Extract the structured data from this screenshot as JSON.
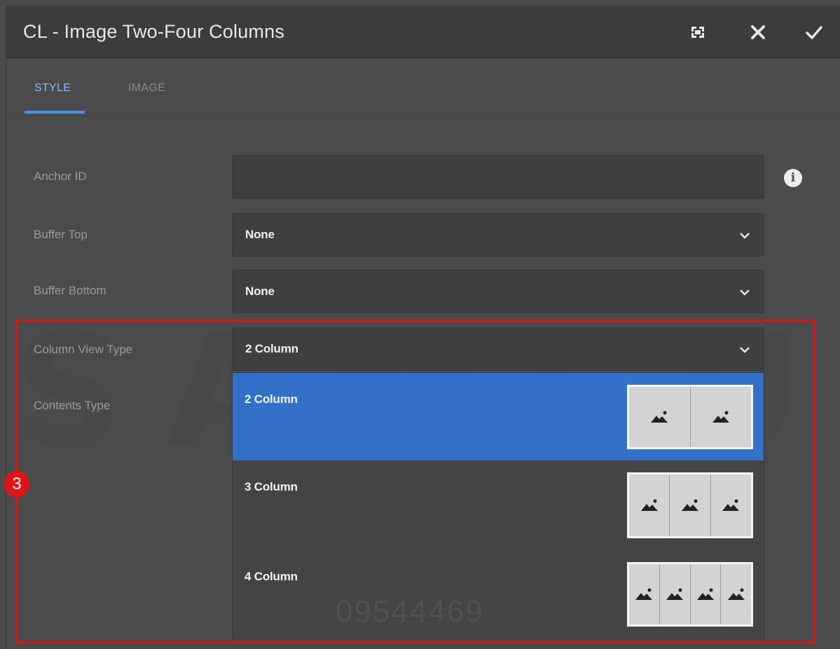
{
  "dialog": {
    "title": "CL - Image Two-Four Columns",
    "toolbar": {
      "fullscreen_icon": "fullscreen-icon",
      "close_icon": "close-icon",
      "confirm_icon": "check-icon"
    }
  },
  "tabs": [
    {
      "label": "STYLE",
      "active": true
    },
    {
      "label": "IMAGE",
      "active": false
    }
  ],
  "form": {
    "anchor_id": {
      "label": "Anchor ID",
      "value": ""
    },
    "buffer_top": {
      "label": "Buffer Top",
      "value": "None"
    },
    "buffer_bottom": {
      "label": "Buffer Bottom",
      "value": "None"
    },
    "column_view_type": {
      "label": "Column View Type",
      "value": "2 Column"
    },
    "contents_type": {
      "label": "Contents Type"
    }
  },
  "dropdown_options": [
    {
      "label": "2 Column",
      "columns": 2,
      "selected": true
    },
    {
      "label": "3 Column",
      "columns": 3,
      "selected": false
    },
    {
      "label": "4 Column",
      "columns": 4,
      "selected": false
    }
  ],
  "annotation": {
    "badge": "3",
    "color": "#e01414"
  },
  "watermark": {
    "brand": "SAMSUNG",
    "number": "09544469"
  },
  "colors": {
    "accent": "#4a90e2",
    "selected_option": "#3371c9",
    "background": "#4b4b4b",
    "titlebar": "#3c3c3c"
  }
}
